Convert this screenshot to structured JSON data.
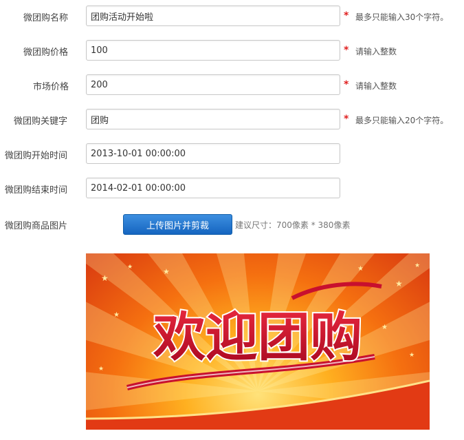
{
  "form": {
    "rows": [
      {
        "label": "微团购名称",
        "value": "团购活动开始啦",
        "required": true,
        "hint": "最多只能输入30个字符。"
      },
      {
        "label": "微团购价格",
        "value": "100",
        "required": true,
        "hint": "请输入整数"
      },
      {
        "label": "市场价格",
        "value": "200",
        "required": true,
        "hint": "请输入整数"
      },
      {
        "label": "微团购关键字",
        "value": "团购",
        "required": true,
        "hint": "最多只能输入20个字符。"
      },
      {
        "label": "微团购开始时间",
        "value": "2013-10-01 00:00:00"
      },
      {
        "label": "微团购结束时间",
        "value": "2014-02-01 00:00:00"
      }
    ],
    "required_mark": "*",
    "image_label": "微团购商品图片",
    "upload_button": "上传图片并剪裁",
    "size_hint": "建议尺寸：700像素 * 380像素"
  },
  "banner": {
    "text": "欢迎团购",
    "colors": {
      "text": "#c8102e",
      "outline": "#ffffff",
      "bg_center": "#ffe27a",
      "bg_edge": "#d83810"
    }
  }
}
